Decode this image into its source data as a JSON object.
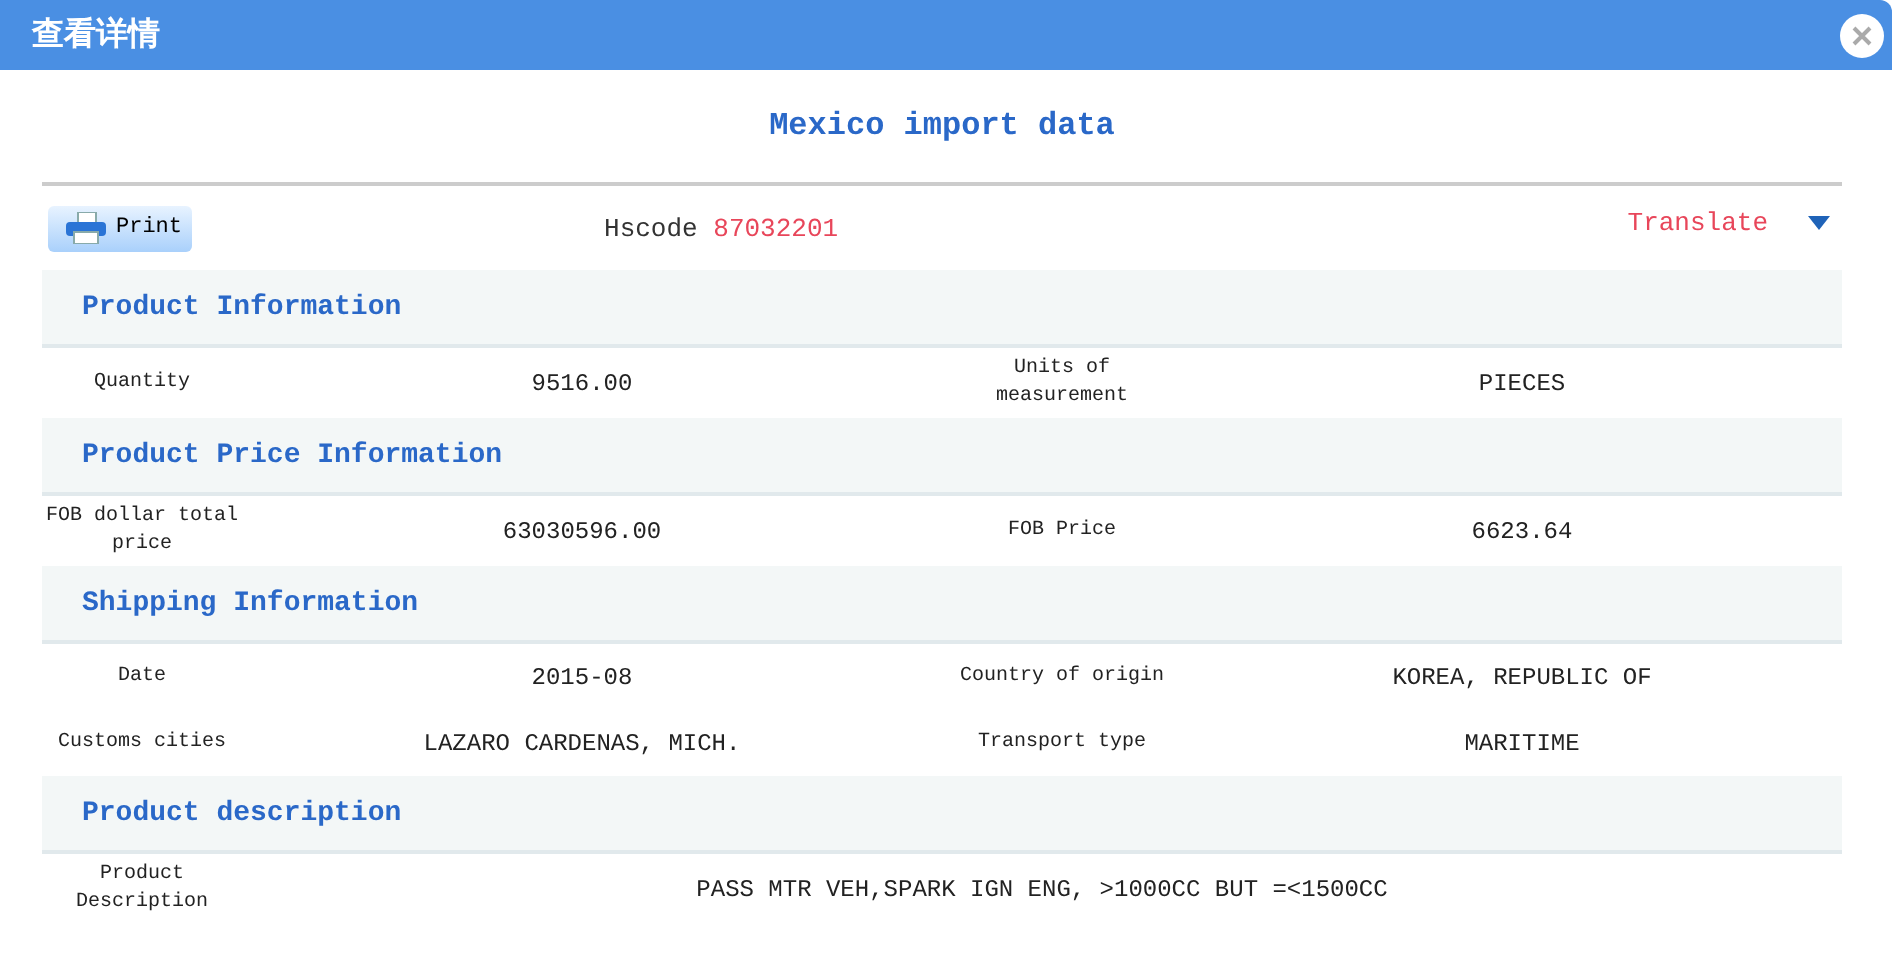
{
  "window": {
    "title": "查看详情"
  },
  "heading": "Mexico import data",
  "toolbar": {
    "print_button": "Print",
    "hscode_label": "Hscode",
    "hscode_value": "87032201",
    "translate": "Translate"
  },
  "sections": [
    {
      "title": "Product Information",
      "rows": [
        {
          "fields": [
            {
              "label": "Quantity",
              "value": "9516.00"
            },
            {
              "label": "Units of measurement",
              "value": "PIECES"
            }
          ]
        }
      ]
    },
    {
      "title": "Product Price Information",
      "rows": [
        {
          "fields": [
            {
              "label": "FOB dollar total price",
              "value": "63030596.00"
            },
            {
              "label": "FOB Price",
              "value": "6623.64"
            }
          ]
        }
      ]
    },
    {
      "title": "Shipping Information",
      "rows": [
        {
          "fields": [
            {
              "label": "Date",
              "value": "2015-08"
            },
            {
              "label": "Country of origin",
              "value": "KOREA, REPUBLIC OF"
            }
          ]
        },
        {
          "fields": [
            {
              "label": "Customs cities",
              "value": "LAZARO CARDENAS, MICH."
            },
            {
              "label": "Transport type",
              "value": "MARITIME"
            }
          ]
        }
      ]
    },
    {
      "title": "Product description",
      "rows": [
        {
          "fields": [
            {
              "label": "Product Description",
              "value": "PASS MTR VEH,SPARK IGN ENG, >1000CC BUT =<1500CC"
            }
          ]
        }
      ]
    }
  ]
}
